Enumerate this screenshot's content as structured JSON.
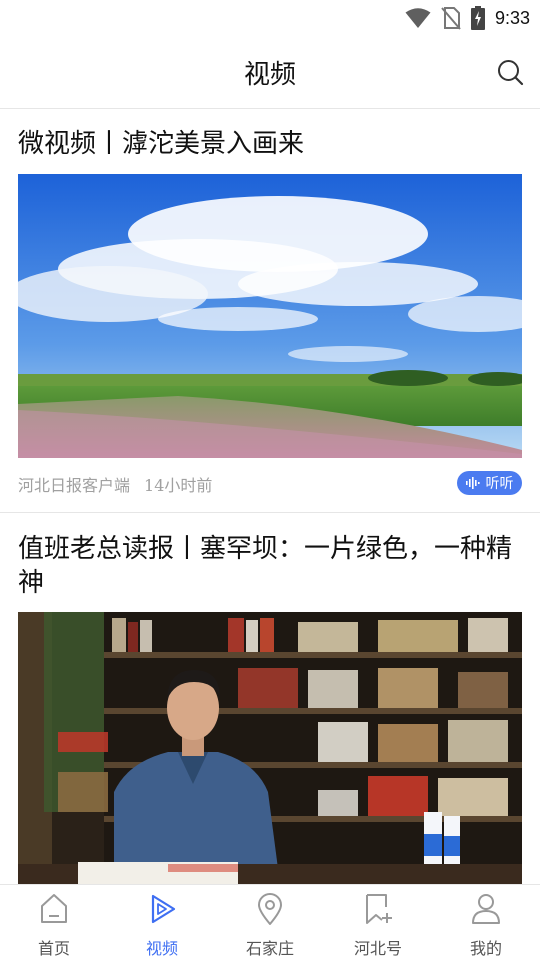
{
  "status_bar": {
    "time": "9:33",
    "icons": [
      "wifi-icon",
      "no-sim-icon",
      "battery-charging-icon"
    ]
  },
  "header": {
    "title": "视频",
    "search_icon": "search-icon"
  },
  "articles": [
    {
      "title": "微视频丨滹沱美景入画来",
      "source": "河北日报客户端",
      "time_ago": "14小时前",
      "listen_label": "听听"
    },
    {
      "title": "值班老总读报丨塞罕坝：一片绿色，一种精神"
    }
  ],
  "tabbar": {
    "items": [
      {
        "label": "首页",
        "icon": "home-icon",
        "active": false
      },
      {
        "label": "视频",
        "icon": "play-icon",
        "active": true
      },
      {
        "label": "石家庄",
        "icon": "location-pin-icon",
        "active": false
      },
      {
        "label": "河北号",
        "icon": "bookmark-add-icon",
        "active": false
      },
      {
        "label": "我的",
        "icon": "user-icon",
        "active": false
      }
    ]
  },
  "colors": {
    "accent": "#3f6ff2",
    "listen_button": "#4b7bf0",
    "meta_text": "#a0a0a0"
  }
}
